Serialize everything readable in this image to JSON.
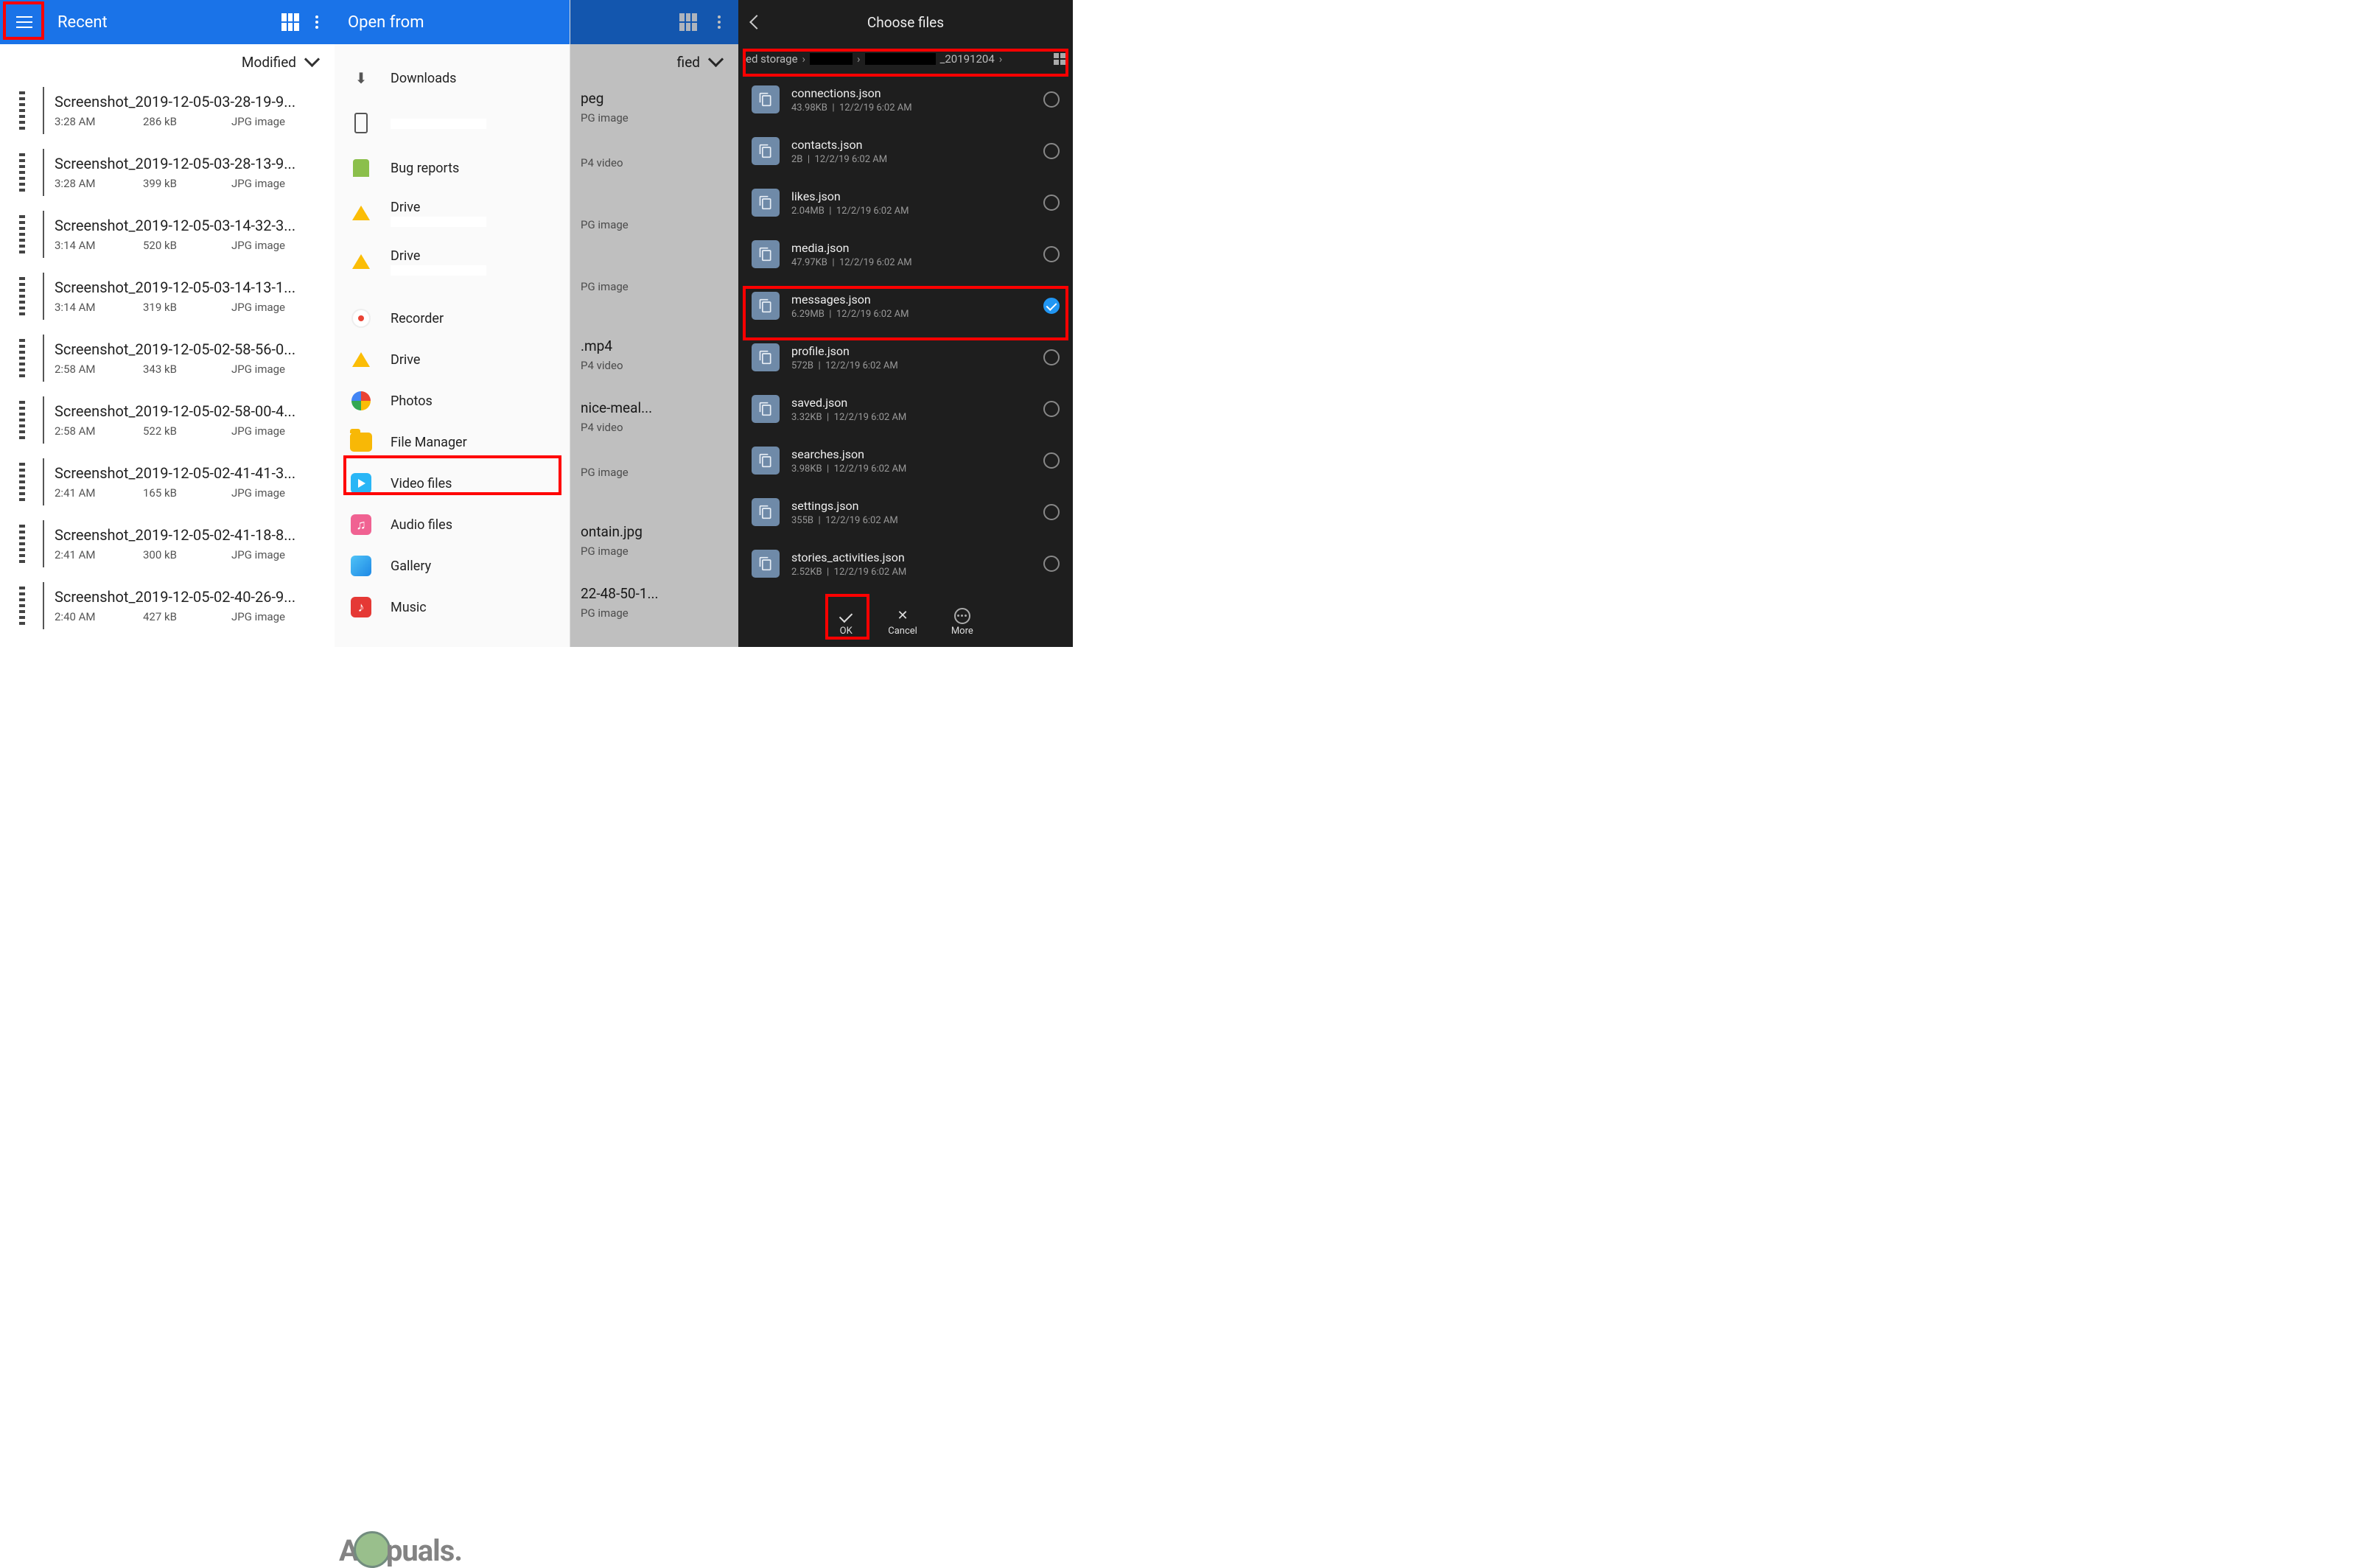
{
  "panel1": {
    "title": "Recent",
    "sort": "Modified",
    "items": [
      {
        "name": "Screenshot_2019-12-05-03-28-19-9...",
        "time": "3:28 AM",
        "size": "286 kB",
        "type": "JPG image"
      },
      {
        "name": "Screenshot_2019-12-05-03-28-13-9...",
        "time": "3:28 AM",
        "size": "399 kB",
        "type": "JPG image"
      },
      {
        "name": "Screenshot_2019-12-05-03-14-32-3...",
        "time": "3:14 AM",
        "size": "520 kB",
        "type": "JPG image"
      },
      {
        "name": "Screenshot_2019-12-05-03-14-13-1...",
        "time": "3:14 AM",
        "size": "319 kB",
        "type": "JPG image"
      },
      {
        "name": "Screenshot_2019-12-05-02-58-56-0...",
        "time": "2:58 AM",
        "size": "343 kB",
        "type": "JPG image"
      },
      {
        "name": "Screenshot_2019-12-05-02-58-00-4...",
        "time": "2:58 AM",
        "size": "522 kB",
        "type": "JPG image"
      },
      {
        "name": "Screenshot_2019-12-05-02-41-41-3...",
        "time": "2:41 AM",
        "size": "165 kB",
        "type": "JPG image"
      },
      {
        "name": "Screenshot_2019-12-05-02-41-18-8...",
        "time": "2:41 AM",
        "size": "300 kB",
        "type": "JPG image"
      },
      {
        "name": "Screenshot_2019-12-05-02-40-26-9...",
        "time": "2:40 AM",
        "size": "427 kB",
        "type": "JPG image"
      }
    ]
  },
  "panel2": {
    "title": "Open from",
    "items": [
      {
        "icon": "download",
        "label": "Downloads"
      },
      {
        "icon": "phone",
        "label": ""
      },
      {
        "icon": "bug",
        "label": "Bug reports"
      },
      {
        "icon": "drive",
        "label": "Drive"
      },
      {
        "icon": "drive",
        "label": "Drive"
      },
      {
        "icon": "rec",
        "label": "Recorder"
      },
      {
        "icon": "drive",
        "label": "Drive"
      },
      {
        "icon": "photos",
        "label": "Photos"
      },
      {
        "icon": "fm",
        "label": "File Manager"
      },
      {
        "icon": "video",
        "label": "Video files"
      },
      {
        "icon": "audio",
        "label": "Audio files"
      },
      {
        "icon": "gallery",
        "label": "Gallery"
      },
      {
        "icon": "music",
        "label": "Music"
      }
    ]
  },
  "panel2b": {
    "sort": "fied",
    "items": [
      {
        "name": "peg",
        "meta": "PG image"
      },
      {
        "name": "",
        "meta": "P4 video"
      },
      {
        "name": "",
        "meta": "PG image"
      },
      {
        "name": "",
        "meta": "PG image"
      },
      {
        "name": ".mp4",
        "meta": "P4 video"
      },
      {
        "name": "nice-meal...",
        "meta": "P4 video"
      },
      {
        "name": "",
        "meta": "PG image"
      },
      {
        "name": "ontain.jpg",
        "meta": "PG image"
      },
      {
        "name": "22-48-50-1...",
        "meta": "PG image"
      }
    ]
  },
  "panel3": {
    "title": "Choose files",
    "crumbs": {
      "first": "ed storage",
      "last": "_20191204"
    },
    "items": [
      {
        "name": "connections.json",
        "size": "43.98KB",
        "date": "12/2/19 6:02 AM",
        "checked": false
      },
      {
        "name": "contacts.json",
        "size": "2B",
        "date": "12/2/19 6:02 AM",
        "checked": false
      },
      {
        "name": "likes.json",
        "size": "2.04MB",
        "date": "12/2/19 6:02 AM",
        "checked": false
      },
      {
        "name": "media.json",
        "size": "47.97KB",
        "date": "12/2/19 6:02 AM",
        "checked": false
      },
      {
        "name": "messages.json",
        "size": "6.29MB",
        "date": "12/2/19 6:02 AM",
        "checked": true
      },
      {
        "name": "profile.json",
        "size": "572B",
        "date": "12/2/19 6:02 AM",
        "checked": false
      },
      {
        "name": "saved.json",
        "size": "3.32KB",
        "date": "12/2/19 6:02 AM",
        "checked": false
      },
      {
        "name": "searches.json",
        "size": "3.98KB",
        "date": "12/2/19 6:02 AM",
        "checked": false
      },
      {
        "name": "settings.json",
        "size": "355B",
        "date": "12/2/19 6:02 AM",
        "checked": false
      },
      {
        "name": "stories_activities.json",
        "size": "2.52KB",
        "date": "12/2/19 6:02 AM",
        "checked": false
      }
    ],
    "buttons": {
      "ok": "OK",
      "cancel": "Cancel",
      "more": "More"
    }
  },
  "watermark": "A   puals"
}
